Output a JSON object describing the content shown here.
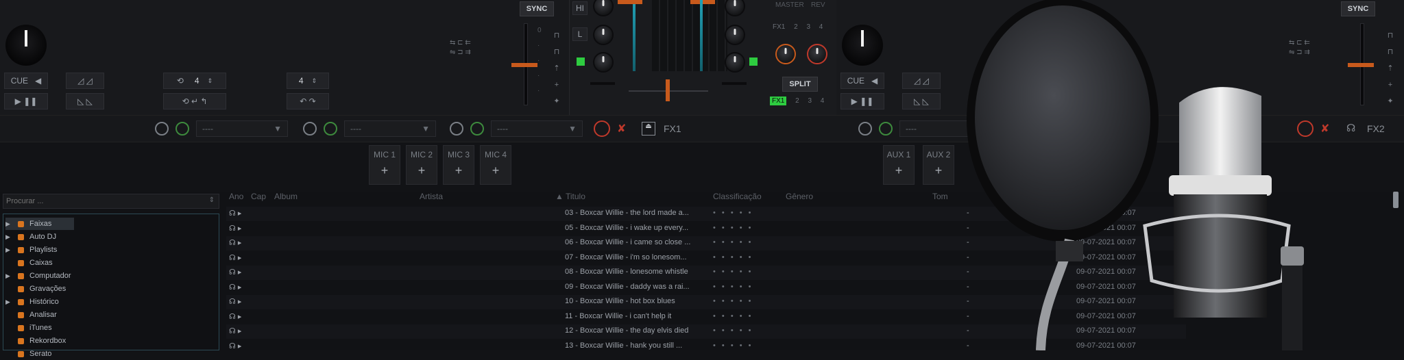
{
  "deck_left": {
    "cue_label": "CUE",
    "sync_label": "SYNC",
    "loop_value_1": "4",
    "loop_value_2": "4"
  },
  "deck_right": {
    "cue_label": "CUE",
    "sync_label": "SYNC"
  },
  "mixer": {
    "high_label": "HI",
    "low_label": "L",
    "fx1_label": "FX1",
    "master_label": "MASTER",
    "split_label": "SPLIT",
    "rev_label": "REV"
  },
  "fx_bars": {
    "left_unit_label": "FX1",
    "right_unit_label": "FX2",
    "dropdown_values": [
      "----",
      "----",
      "----",
      "----"
    ]
  },
  "mic_inputs": [
    {
      "label": "MIC 1",
      "add": "+"
    },
    {
      "label": "MIC 2",
      "add": "+"
    },
    {
      "label": "MIC 3",
      "add": "+"
    },
    {
      "label": "MIC 4",
      "add": "+"
    },
    {
      "label": "AUX 1",
      "add": "+"
    },
    {
      "label": "AUX 2",
      "add": "+"
    }
  ],
  "browser": {
    "search_placeholder": "Procurar ...",
    "tree": [
      {
        "label": "Faixas",
        "expand": "▶",
        "selected": true
      },
      {
        "label": "Auto DJ",
        "expand": "▶"
      },
      {
        "label": "Playlists",
        "expand": "▶"
      },
      {
        "label": "Caixas",
        "expand": ""
      },
      {
        "label": "Computador",
        "expand": "▶"
      },
      {
        "label": "Gravações",
        "expand": ""
      },
      {
        "label": "Histórico",
        "expand": "▶"
      },
      {
        "label": "Analisar",
        "expand": ""
      },
      {
        "label": "iTunes",
        "expand": ""
      },
      {
        "label": "Rekordbox",
        "expand": ""
      },
      {
        "label": "Serato",
        "expand": ""
      }
    ],
    "columns": [
      "Ano",
      "Cap",
      "Album",
      "Artista",
      "▲ Titulo",
      "Classificação",
      "Gênero",
      "Tom"
    ],
    "rows": [
      {
        "title": "03 - Boxcar Willie - the lord made a...",
        "rating": "• • • • •"
      },
      {
        "title": "05 - Boxcar Willie - i wake up every...",
        "rating": "• • • • •"
      },
      {
        "title": "06 - Boxcar Willie - i came so close ...",
        "rating": "• • • • •"
      },
      {
        "title": "07 - Boxcar Willie - i'm so lonesom...",
        "rating": "• • • • •"
      },
      {
        "title": "08 - Boxcar Willie - lonesome whistle",
        "rating": "• • • • •"
      },
      {
        "title": "09 - Boxcar Willie - daddy was a rai...",
        "rating": "• • • • •"
      },
      {
        "title": "10 - Boxcar Willie - hot box blues",
        "rating": "• • • • •"
      },
      {
        "title": "11 - Boxcar Willie - i can't help it",
        "rating": "• • • • •"
      },
      {
        "title": "12 - Boxcar Willie - the day elvis died",
        "rating": "• • • • •"
      },
      {
        "title": "13 - Boxcar Willie - hank you still ...",
        "rating": "• • • • •"
      }
    ],
    "dates": [
      "09-07-2021 00:07",
      "09-07-2021 00:07",
      "09-07-2021 00:07",
      "09-07-2021 00:07",
      "09-07-2021 00:07",
      "09-07-2021 00:07",
      "09-07-2021 00:07",
      "09-07-2021 00:07",
      "09-07-2021 00:07",
      "09-07-2021 00:07"
    ]
  },
  "colors": {
    "accent_orange": "#d9751f",
    "accent_red": "#c0392b",
    "accent_green": "#2ecc40",
    "panel_bg": "#18191c"
  }
}
